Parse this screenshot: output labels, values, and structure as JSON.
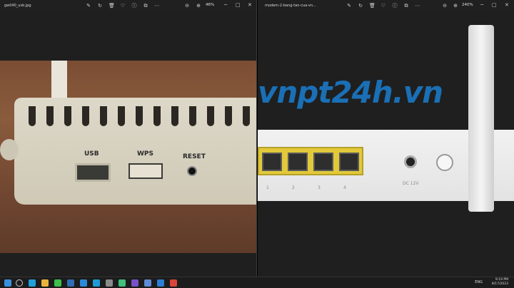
{
  "left_window": {
    "filename": "gw040_usb.jpg",
    "zoom": "46%"
  },
  "right_window": {
    "filename": "modem-2-bang-tan-cua-vn...",
    "zoom": "240%",
    "watermark": "vnpt24h.vn"
  },
  "left_photo": {
    "labels": {
      "usb": "USB",
      "wps": "WPS",
      "reset": "RESET"
    }
  },
  "right_photo": {
    "lan_numbers": [
      "1",
      "2",
      "3",
      "4"
    ],
    "dc_label": "DC 12V"
  },
  "taskbar": {
    "lang": "ENG",
    "time": "9:19 PM",
    "date": "8/17/2023"
  },
  "colors": {
    "watermark": "#1a6fb5",
    "lan_block": "#e2c93a"
  }
}
